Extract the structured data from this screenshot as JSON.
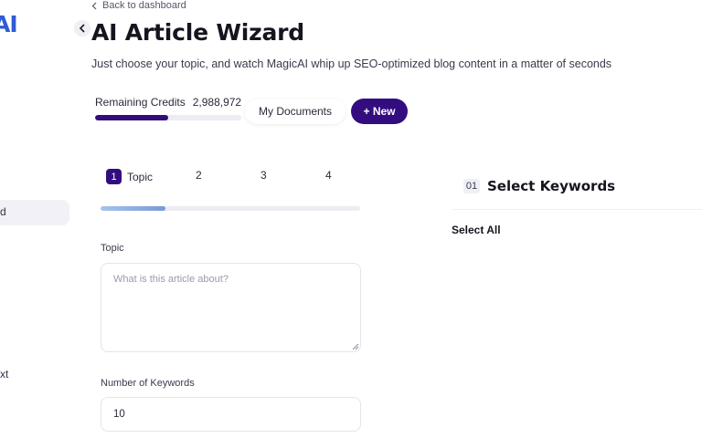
{
  "sidebar": {
    "brand_fragment": "AI",
    "active_item_fragment": "d",
    "item_fragment": "xt"
  },
  "header": {
    "back_label": "Back to dashboard",
    "title": "AI Article Wizard",
    "subtitle": "Just choose your topic, and watch MagicAI whip up SEO-optimized blog content in a matter of seconds"
  },
  "credits": {
    "label": "Remaining Credits",
    "value": "2,988,972",
    "usage_fraction": 0.5
  },
  "actions": {
    "my_documents_label": "My Documents",
    "new_label": "+ New"
  },
  "wizard": {
    "steps": [
      {
        "number": "1",
        "label": "Topic"
      },
      {
        "number": "2",
        "label": ""
      },
      {
        "number": "3",
        "label": ""
      },
      {
        "number": "4",
        "label": ""
      }
    ],
    "progress_fraction": 0.25,
    "topic": {
      "label": "Topic",
      "value": "",
      "placeholder": "What is this article about?"
    },
    "keywords_count": {
      "label": "Number of Keywords",
      "value": "10"
    }
  },
  "keywords_panel": {
    "step_number": "01",
    "title": "Select Keywords",
    "select_all_label": "Select All"
  },
  "colors": {
    "primary": "#330d7f",
    "step_progress": "#7b98da",
    "brand": "#2e5bd6"
  }
}
